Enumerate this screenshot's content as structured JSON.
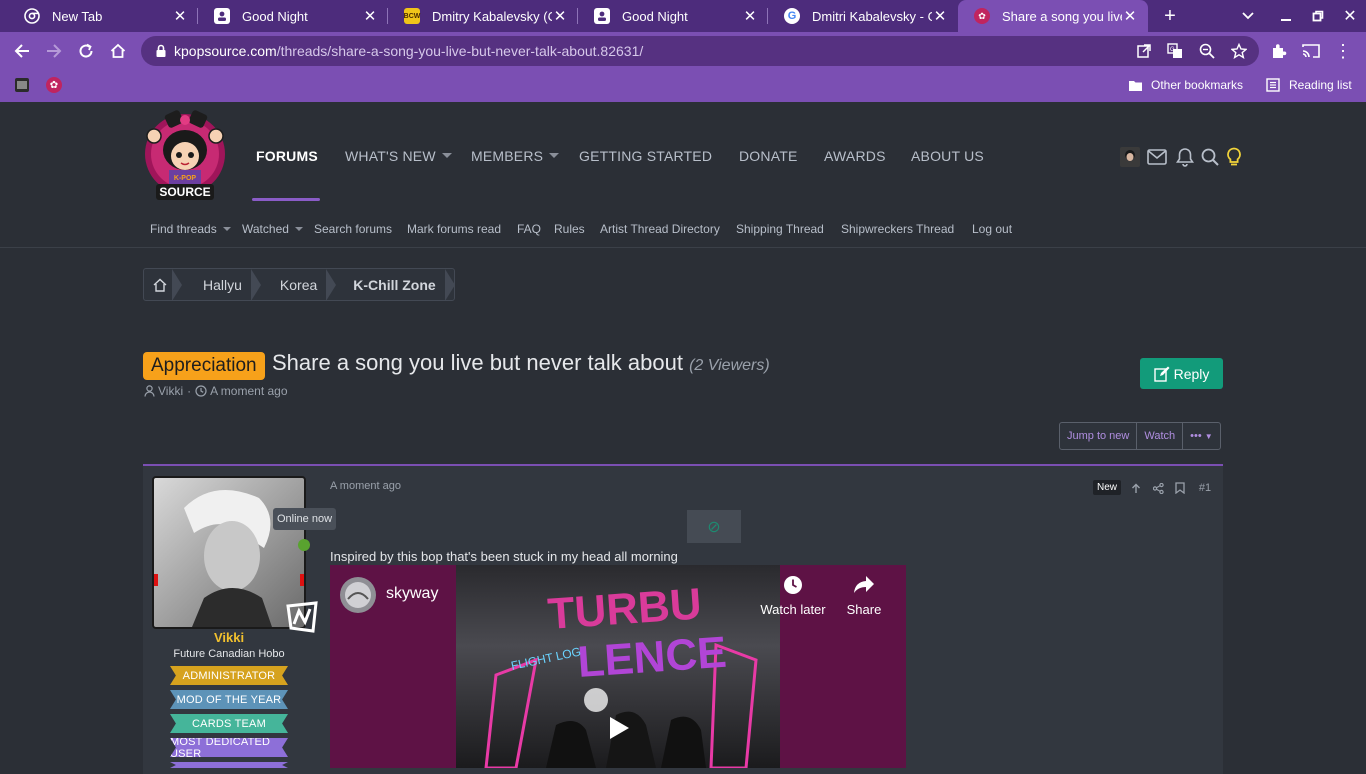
{
  "browser": {
    "tabs": [
      {
        "label": "New Tab",
        "favicon": "chrome-icon"
      },
      {
        "label": "Good Night",
        "favicon": "contact-icon"
      },
      {
        "label": "Dmitry Kabalevsky (Composer)",
        "favicon": "bcw-icon"
      },
      {
        "label": "Good Night",
        "favicon": "contact-icon"
      },
      {
        "label": "Dmitri Kabalevsky - Google Search",
        "favicon": "google-icon"
      },
      {
        "label": "Share a song you live but never talk about",
        "favicon": "kpopsource-icon"
      }
    ],
    "url_host": "kpopsource.com",
    "url_path": "/threads/share-a-song-you-live-but-never-talk-about.82631/",
    "bookmarks": {
      "other": "Other bookmarks",
      "reading_list": "Reading list"
    },
    "colors": {
      "tabbar": "#4d2c7c",
      "toolbar": "#7b4fb3"
    }
  },
  "site": {
    "logo_text": "SOURCE",
    "logo_subtext": "K-POP",
    "nav": [
      "FORUMS",
      "WHAT'S NEW",
      "MEMBERS",
      "GETTING STARTED",
      "DONATE",
      "AWARDS",
      "ABOUT US"
    ],
    "subnav": [
      "Find threads",
      "Watched",
      "Search forums",
      "Mark forums read",
      "FAQ",
      "Rules",
      "Artist Thread Directory",
      "Shipping Thread",
      "Shipwreckers Thread",
      "Log out"
    ]
  },
  "breadcrumbs": [
    "Hallyu",
    "Korea",
    "K-Chill Zone"
  ],
  "thread": {
    "prefix": "Appreciation",
    "title": "Share a song you live but never talk about",
    "viewers": "(2 Viewers)",
    "author": "Vikki",
    "time": "A moment ago",
    "reply_label": "Reply",
    "buttons": {
      "jump": "Jump to new",
      "watch": "Watch",
      "more": "•••"
    }
  },
  "post": {
    "time": "A moment ago",
    "new_label": "New",
    "number": "#1",
    "online_tip": "Online now",
    "username": "Vikki",
    "user_title": "Future Canadian Hobo",
    "banners": [
      {
        "label": "ADMINISTRATOR",
        "color": "#d6a21e"
      },
      {
        "label": "MOD OF THE YEAR",
        "color": "#5d93b8"
      },
      {
        "label": "CARDS TEAM",
        "color": "#45b59a"
      },
      {
        "label": "MOST DEDICATED USER",
        "color": "#8d6fd8"
      }
    ],
    "text": "Inspired by this bop that's been stuck in my head all morning",
    "video": {
      "channel": "skyway",
      "watch_later": "Watch later",
      "share": "Share",
      "art_text_1": "TURBU",
      "art_text_2": "LENCE",
      "art_text_3": "FLIGHT LOG"
    }
  }
}
